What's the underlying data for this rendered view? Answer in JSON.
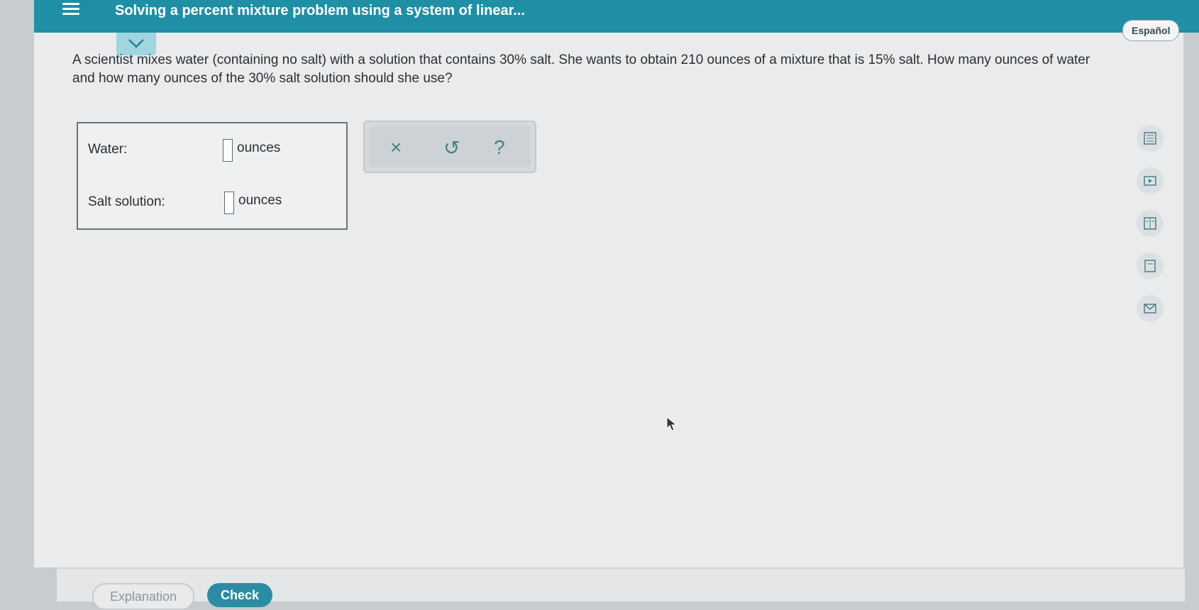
{
  "header": {
    "title": "Solving a percent mixture problem using a system of linear..."
  },
  "language_button": "Español",
  "question": {
    "text": "A scientist mixes water (containing no salt) with a solution that contains 30% salt. She wants to obtain 210 ounces of a mixture that is 15% salt. How many ounces of water and how many ounces of the 30% salt solution should she use?"
  },
  "answers": [
    {
      "label": "Water:",
      "value": "",
      "unit": "ounces"
    },
    {
      "label": "Salt solution:",
      "value": "",
      "unit": "ounces"
    }
  ],
  "toolbox": {
    "clear": "×",
    "undo": "↺",
    "help": "?"
  },
  "side_icons": [
    "calculator-icon",
    "video-icon",
    "book-icon",
    "glossary-icon",
    "mail-icon"
  ],
  "footer": {
    "explanation": "Explanation",
    "check": "Check"
  },
  "colors": {
    "header": "#1f8fa6",
    "accent": "#2c8ca3",
    "collapse": "#9fd6e0"
  }
}
